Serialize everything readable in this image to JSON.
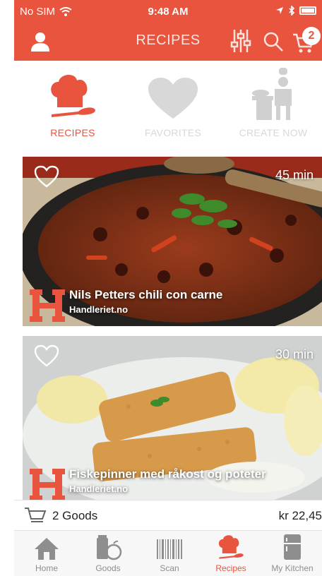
{
  "status_bar": {
    "carrier": "No SIM",
    "time": "9:48 AM"
  },
  "header": {
    "title": "RECIPES",
    "cart_count": "2"
  },
  "categories": [
    {
      "label": "RECIPES"
    },
    {
      "label": "FAVORITES"
    },
    {
      "label": "CREATE NOW"
    }
  ],
  "recipes": [
    {
      "time": "45 min",
      "name": "Nils Petters chili con carne",
      "source": "Handleriet.no",
      "logo_letter": "H"
    },
    {
      "time": "30 min",
      "name": "Fiskepinner med råkost og poteter",
      "source": "Handleriet.no",
      "logo_letter": "H"
    }
  ],
  "basket": {
    "count_label": "2 Goods",
    "total": "kr 22,45"
  },
  "tabs": [
    {
      "label": "Home"
    },
    {
      "label": "Goods"
    },
    {
      "label": "Scan"
    },
    {
      "label": "Recipes"
    },
    {
      "label": "My Kitchen"
    }
  ],
  "colors": {
    "accent": "#e8543e",
    "inactive": "#8e8e8e"
  }
}
